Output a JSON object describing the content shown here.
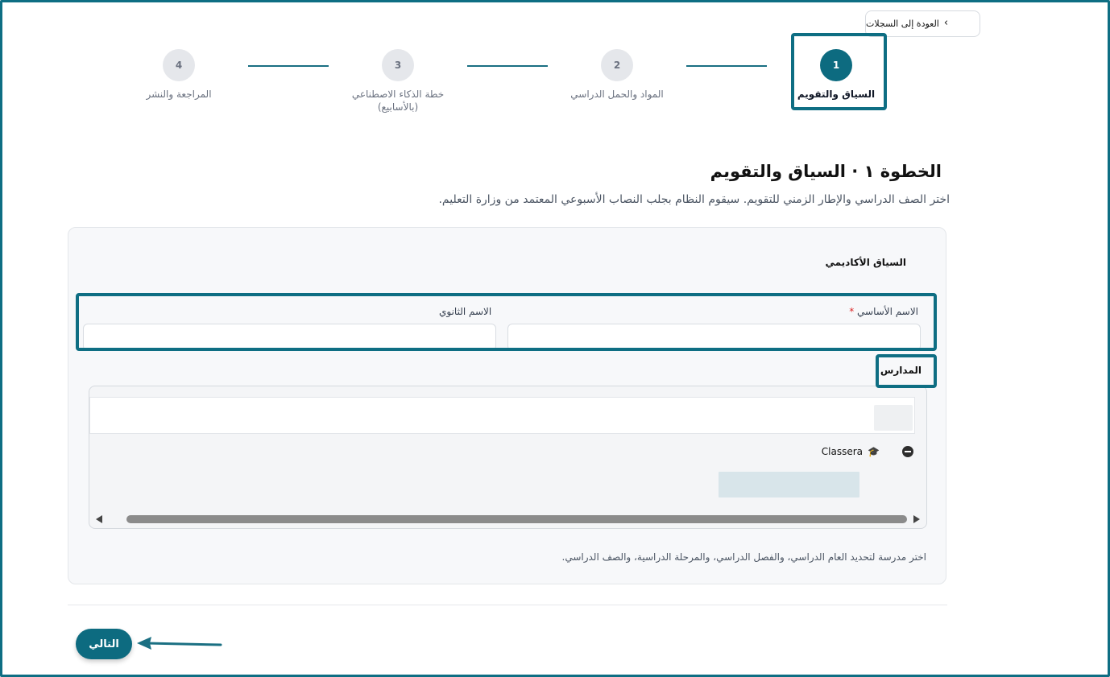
{
  "back_button": {
    "label": "العودة إلى السجلات"
  },
  "stepper": {
    "steps": [
      {
        "number": "1",
        "label": "السياق والتقويم",
        "active": true
      },
      {
        "number": "2",
        "label": "المواد والحمل الدراسي",
        "active": false
      },
      {
        "number": "3",
        "label": "خطة الذكاء الاصطناعي (بالأسابيع)",
        "active": false
      },
      {
        "number": "4",
        "label": "المراجعة والنشر",
        "active": false
      }
    ]
  },
  "heading": {
    "title": "الخطوة ١ · السياق والتقويم",
    "subtitle": "اختر الصف الدراسي والإطار الزمني للتقويم. سيقوم النظام بجلب النصاب الأسبوعي المعتمد من وزارة التعليم."
  },
  "academic_context": {
    "section_title": "السياق الأكاديمي",
    "primary_name_label": "الاسم الأساسي",
    "primary_name_required": "*",
    "primary_name_value": "",
    "secondary_name_label": "الاسم الثانوي",
    "secondary_name_value": ""
  },
  "schools": {
    "title": "المدارس",
    "tree_item_label": "Classera",
    "helper_text": "اختر مدرسة لتحديد العام الدراسي، والفصل الدراسي، والمرحلة الدراسية، والصف الدراسي."
  },
  "footer": {
    "next_label": "التالي"
  },
  "colors": {
    "accent": "#0d6b80",
    "highlight": "#0e6e83"
  },
  "icons": {
    "back": "chevron-right-icon",
    "school": "graduation-cap-icon",
    "collapse": "minus-circle-icon"
  }
}
